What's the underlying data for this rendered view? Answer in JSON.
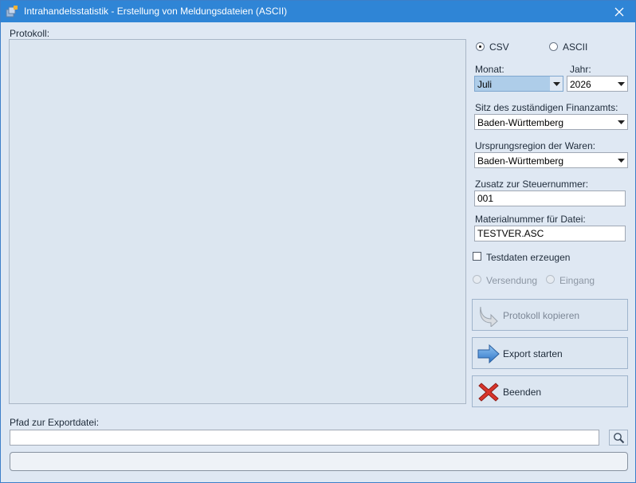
{
  "window": {
    "title": "Intrahandelsstatistik - Erstellung von Meldungsdateien (ASCII)",
    "accent_color": "#2f85d6"
  },
  "protocol": {
    "label": "Protokoll:"
  },
  "format": {
    "options": [
      {
        "label": "CSV",
        "checked": true
      },
      {
        "label": "ASCII",
        "checked": false
      }
    ]
  },
  "period": {
    "month_label": "Monat:",
    "month_value": "Juli",
    "year_label": "Jahr:",
    "year_value": "2026"
  },
  "tax_office": {
    "label": "Sitz des zuständigen Finanzamts:",
    "value": "Baden-Württemberg"
  },
  "origin_region": {
    "label": "Ursprungsregion der Waren:",
    "value": "Baden-Württemberg"
  },
  "tax_suffix": {
    "label": "Zusatz zur Steuernummer:",
    "value": "001"
  },
  "material_number": {
    "label": "Materialnummer für Datei:",
    "value": "TESTVER.ASC"
  },
  "test_data": {
    "label": "Testdaten erzeugen",
    "checked": false
  },
  "direction": {
    "options": [
      {
        "label": "Versendung",
        "enabled": false
      },
      {
        "label": "Eingang",
        "enabled": false
      }
    ]
  },
  "buttons": {
    "copy_protocol": "Protokoll kopieren",
    "start_export": "Export starten",
    "quit": "Beenden"
  },
  "export_path": {
    "label": "Pfad zur Exportdatei:",
    "value": ""
  },
  "progress": {
    "value": 0
  }
}
